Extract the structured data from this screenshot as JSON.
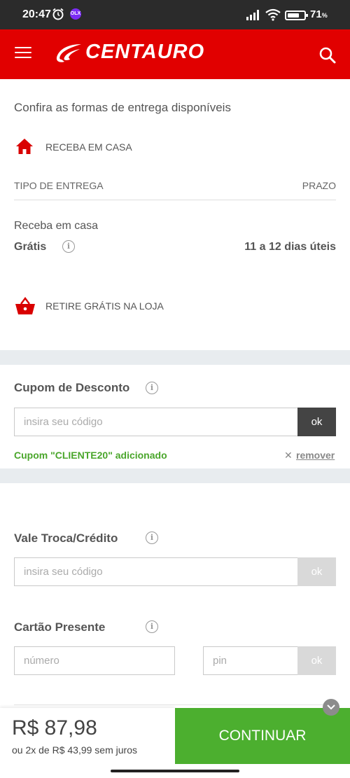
{
  "status_bar": {
    "time": "20:47",
    "battery": "71",
    "battery_level": 0.71,
    "app_badge": "OLX"
  },
  "header": {
    "brand": "CENTAURO",
    "brand_color": "#e10000"
  },
  "delivery": {
    "title": "Confira as formas de entrega disponíveis",
    "home_option": "RECEBA EM CASA",
    "table": {
      "type_header": "TIPO DE ENTREGA",
      "term_header": "PRAZO"
    },
    "shipping": {
      "name": "Receba em casa",
      "price": "Grátis",
      "term": "11 a 12 dias úteis"
    },
    "pickup_option": "RETIRE GRÁTIS NA LOJA"
  },
  "coupon": {
    "title": "Cupom de Desconto",
    "placeholder": "insira seu código",
    "button": "ok",
    "applied_message": "Cupom \"CLIENTE20\" adicionado",
    "remove_link": "remover",
    "applied_color": "#4aa62b"
  },
  "credit": {
    "title": "Vale Troca/Crédito",
    "placeholder": "insira seu código",
    "button": "ok"
  },
  "gift_card": {
    "title": "Cartão Presente",
    "number_placeholder": "número",
    "pin_placeholder": "pin",
    "button": "ok"
  },
  "footer": {
    "total": "R$ 87,98",
    "installments": "ou 2x de R$ 43,99 sem juros",
    "continue_button": "CONTINUAR",
    "continue_color": "#4caf2f"
  }
}
